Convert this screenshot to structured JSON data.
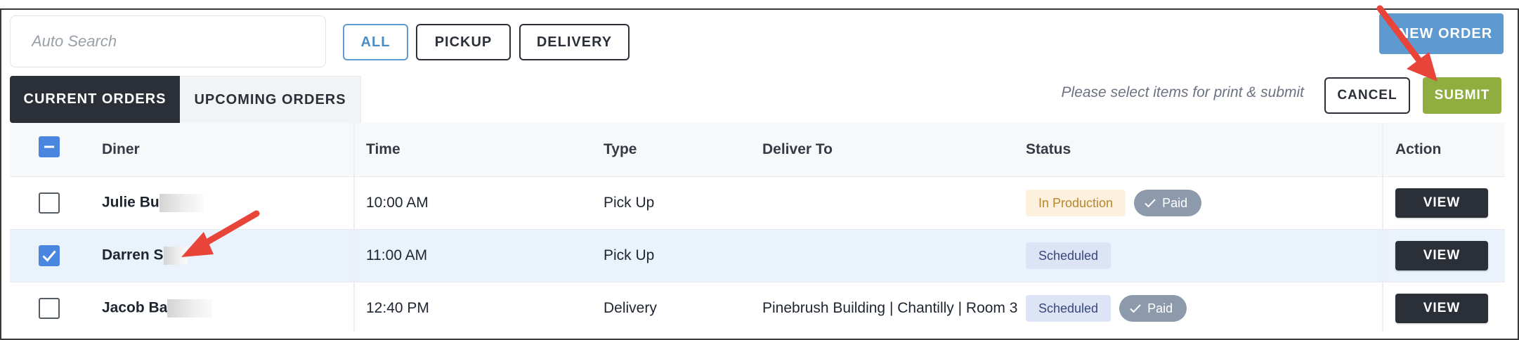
{
  "search": {
    "placeholder": "Auto Search"
  },
  "filters": [
    {
      "label": "ALL",
      "active": true
    },
    {
      "label": "PICKUP",
      "active": false
    },
    {
      "label": "DELIVERY",
      "active": false
    }
  ],
  "toolbar": {
    "new_order_label": "NEW ORDER",
    "hint": "Please select items for print & submit",
    "cancel_label": "CANCEL",
    "submit_label": "SUBMIT"
  },
  "tabs": [
    {
      "label": "CURRENT ORDERS",
      "active": true
    },
    {
      "label": "UPCOMING ORDERS",
      "active": false
    }
  ],
  "table": {
    "columns": [
      "Diner",
      "Time",
      "Type",
      "Deliver To",
      "Status",
      "Action"
    ],
    "rows": [
      {
        "selected": false,
        "diner": "Julie Bu",
        "time": "10:00 AM",
        "type": "Pick Up",
        "deliver_to": "",
        "status": "In Production",
        "paid": "Paid",
        "action": "VIEW"
      },
      {
        "selected": true,
        "diner": "Darren S",
        "time": "11:00 AM",
        "type": "Pick Up",
        "deliver_to": "",
        "status": "Scheduled",
        "paid": "",
        "action": "VIEW"
      },
      {
        "selected": false,
        "diner": "Jacob Ba",
        "time": "12:40 PM",
        "type": "Delivery",
        "deliver_to": "Pinebrush Building | Chantilly | Room 3",
        "status": "Scheduled",
        "paid": "Paid",
        "action": "VIEW"
      }
    ]
  },
  "colors": {
    "accent_blue": "#5e9acf",
    "submit_green": "#8fae3f",
    "dark": "#2a2f38",
    "annotation_arrow": "#e8443a"
  },
  "icons": [
    "minus-icon",
    "check-icon",
    "annotation-arrow-icon"
  ]
}
